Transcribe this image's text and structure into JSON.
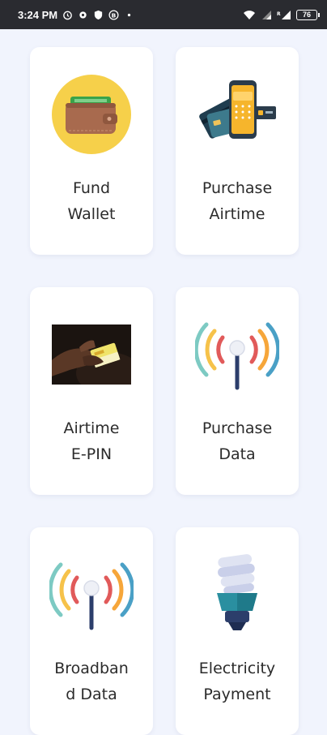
{
  "status_bar": {
    "time": "3:24 PM",
    "left_icons": [
      "alarm-icon",
      "gear-icon",
      "shield-icon",
      "b-circle-icon",
      "dot-icon"
    ],
    "right_icons": [
      "wifi-icon",
      "signal-icon",
      "signal-r-icon"
    ],
    "battery": "76"
  },
  "services": [
    {
      "line1": "Fund",
      "line2": "Wallet",
      "icon": "wallet-icon"
    },
    {
      "line1": "Purchase",
      "line2": "Airtime",
      "icon": "phone-cards-icon"
    },
    {
      "line1": "Airtime",
      "line2": "E-PIN",
      "icon": "card-photo-image"
    },
    {
      "line1": "Purchase",
      "line2": "Data",
      "icon": "signal-tower-icon"
    },
    {
      "line1": "Broadban",
      "line2": "d Data",
      "icon": "broadband-tower-icon"
    },
    {
      "line1": "Electricity",
      "line2": "Payment",
      "icon": "light-bulb-icon"
    }
  ],
  "colors": {
    "background": "#f1f4fd",
    "card": "#ffffff",
    "text": "#2b2b2b",
    "status_bar": "#2a2b30"
  }
}
